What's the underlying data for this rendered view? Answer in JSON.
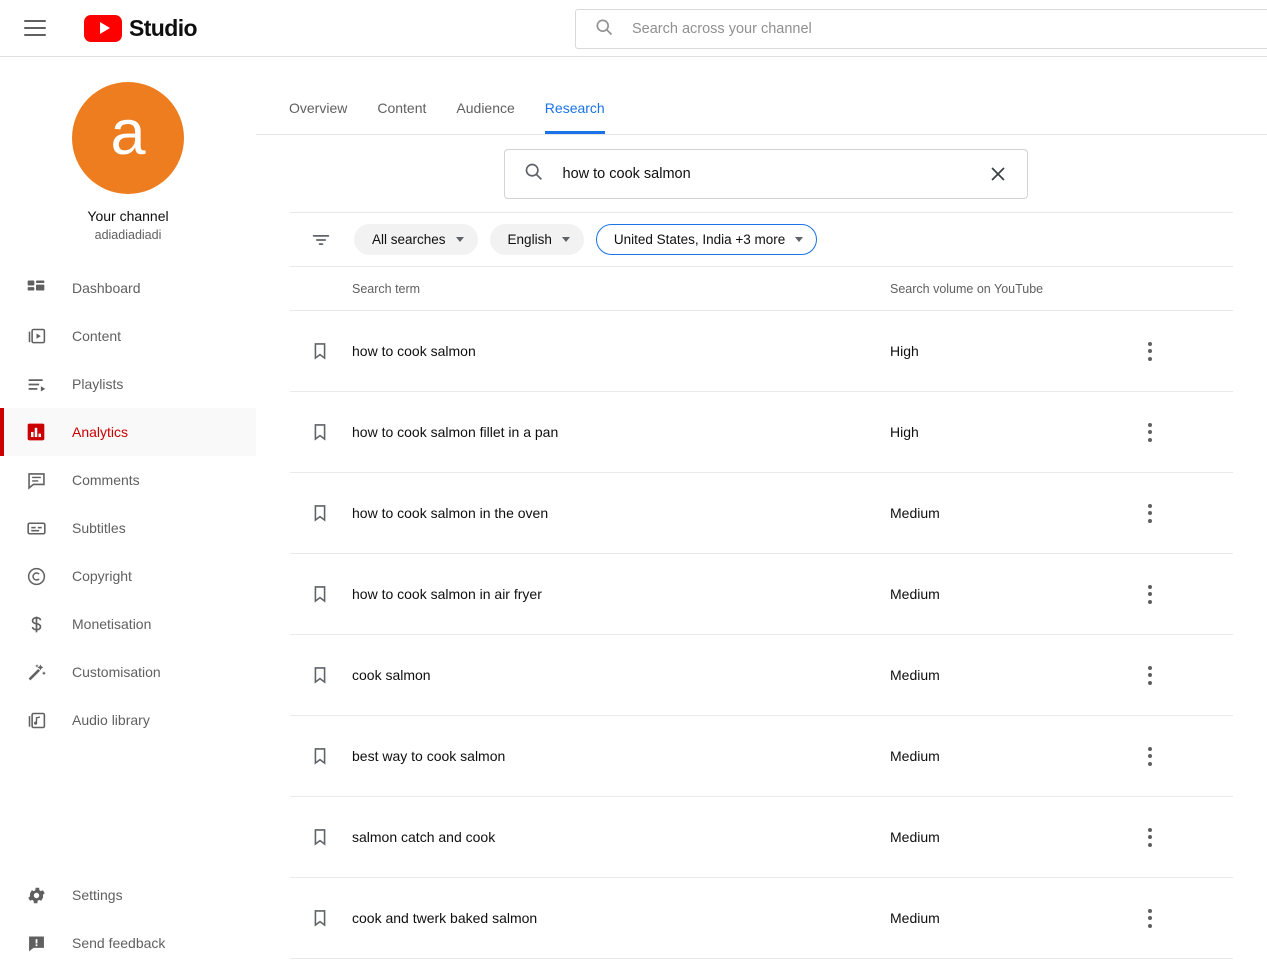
{
  "topbar": {
    "menu_icon": "hamburger-menu-icon",
    "logo_icon": "youtube-play-icon",
    "brand": "Studio",
    "search": {
      "icon": "search-icon",
      "placeholder": "Search across your channel",
      "value": ""
    }
  },
  "sidebar": {
    "avatar_letter": "a",
    "avatar_color": "#ED7D1F",
    "channel_title": "Your channel",
    "channel_handle": "adiadiadiadi",
    "items": [
      {
        "label": "Dashboard",
        "icon": "dashboard-icon",
        "active": false
      },
      {
        "label": "Content",
        "icon": "content-icon",
        "active": false
      },
      {
        "label": "Playlists",
        "icon": "playlists-icon",
        "active": false
      },
      {
        "label": "Analytics",
        "icon": "analytics-icon",
        "active": true
      },
      {
        "label": "Comments",
        "icon": "comments-icon",
        "active": false
      },
      {
        "label": "Subtitles",
        "icon": "subtitles-icon",
        "active": false
      },
      {
        "label": "Copyright",
        "icon": "copyright-icon",
        "active": false
      },
      {
        "label": "Monetisation",
        "icon": "dollar-icon",
        "active": false
      },
      {
        "label": "Customisation",
        "icon": "magic-wand-icon",
        "active": false
      },
      {
        "label": "Audio library",
        "icon": "audio-note-icon",
        "active": false
      }
    ],
    "bottom_items": [
      {
        "label": "Settings",
        "icon": "gear-icon"
      },
      {
        "label": "Send feedback",
        "icon": "feedback-icon"
      }
    ],
    "active_color": "#cc0000"
  },
  "main": {
    "tabs": [
      {
        "label": "Overview",
        "active": false
      },
      {
        "label": "Content",
        "active": false
      },
      {
        "label": "Audience",
        "active": false
      },
      {
        "label": "Research",
        "active": true
      }
    ],
    "active_tab_color": "#1a73e8",
    "research_search": {
      "icon": "search-icon",
      "value": "how to cook salmon",
      "clear_icon": "close-icon"
    },
    "filters": {
      "filter_icon": "filter-list-icon",
      "chips": [
        {
          "label": "All searches",
          "outlined": false,
          "caret": "chevron-down-icon"
        },
        {
          "label": "English",
          "outlined": false,
          "caret": "chevron-down-icon"
        },
        {
          "label": "United States, India +3 more",
          "outlined": true,
          "caret": "chevron-down-icon"
        }
      ]
    },
    "table": {
      "headers": {
        "term": "Search term",
        "volume": "Search volume on YouTube"
      },
      "rows": [
        {
          "bookmark_icon": "bookmark-icon",
          "term": "how to cook salmon",
          "volume": "High",
          "menu_icon": "more-vertical-icon"
        },
        {
          "bookmark_icon": "bookmark-icon",
          "term": "how to cook salmon fillet in a pan",
          "volume": "High",
          "menu_icon": "more-vertical-icon"
        },
        {
          "bookmark_icon": "bookmark-icon",
          "term": "how to cook salmon in the oven",
          "volume": "Medium",
          "menu_icon": "more-vertical-icon"
        },
        {
          "bookmark_icon": "bookmark-icon",
          "term": "how to cook salmon in air fryer",
          "volume": "Medium",
          "menu_icon": "more-vertical-icon"
        },
        {
          "bookmark_icon": "bookmark-icon",
          "term": "cook salmon",
          "volume": "Medium",
          "menu_icon": "more-vertical-icon"
        },
        {
          "bookmark_icon": "bookmark-icon",
          "term": "best way to cook salmon",
          "volume": "Medium",
          "menu_icon": "more-vertical-icon"
        },
        {
          "bookmark_icon": "bookmark-icon",
          "term": "salmon catch and cook",
          "volume": "Medium",
          "menu_icon": "more-vertical-icon"
        },
        {
          "bookmark_icon": "bookmark-icon",
          "term": "cook and twerk baked salmon",
          "volume": "Medium",
          "menu_icon": "more-vertical-icon"
        }
      ]
    }
  }
}
